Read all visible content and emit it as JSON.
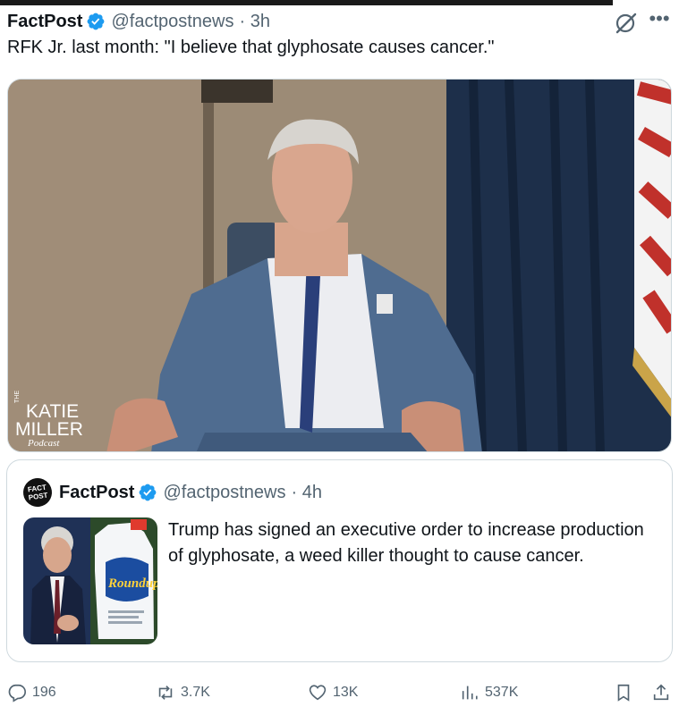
{
  "tweet": {
    "author_name": "FactPost",
    "handle": "@factpostnews",
    "time": "· 3h",
    "text": "RFK Jr. last month: \"I believe that glyphosate causes cancer.\"",
    "media": {
      "watermark_the": "THE",
      "watermark_line1": "KATIE",
      "watermark_line2": "MILLER",
      "watermark_line3": "Podcast"
    }
  },
  "quote": {
    "avatar_line1": "FACT",
    "avatar_line2": "POST",
    "author_name": "FactPost",
    "handle": "@factpostnews",
    "time": "· 4h",
    "text": "Trump has signed an executive order to increase production of glyphosate, a weed killer thought to cause cancer.",
    "thumb_brand": "Roundup"
  },
  "actions": {
    "replies": "196",
    "reposts": "3.7K",
    "likes": "13K",
    "views": "537K"
  },
  "colors": {
    "verified": "#1d9bf0",
    "muted": "#536471",
    "border": "#cfd9de"
  }
}
